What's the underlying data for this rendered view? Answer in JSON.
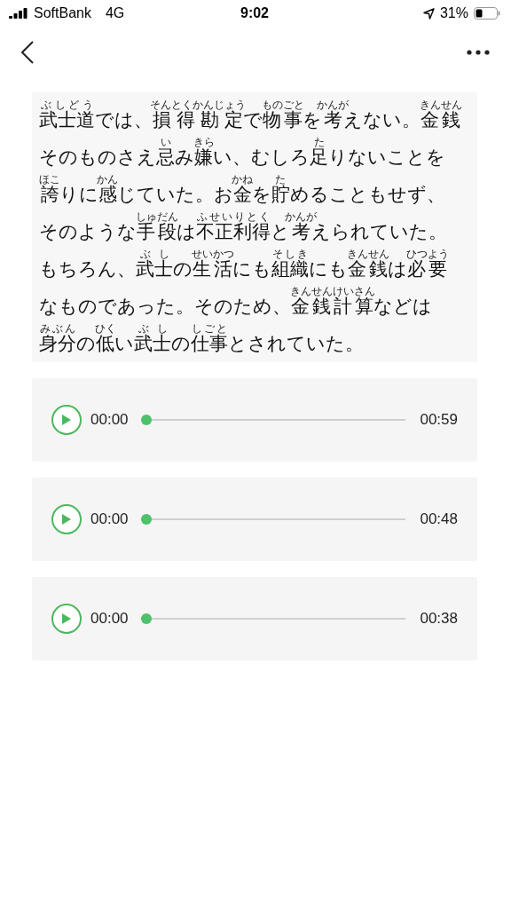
{
  "status_bar": {
    "carrier": "SoftBank",
    "network": "4G",
    "time": "9:02",
    "battery": "31%"
  },
  "passage": {
    "lines": [
      {
        "segments": [
          {
            "text": "武士道",
            "ruby": "ぶしどう"
          },
          {
            "text": "では、"
          },
          {
            "text": "損得勘定",
            "ruby": "そんとくかんじょう"
          },
          {
            "text": "で"
          },
          {
            "text": "物事",
            "ruby": "ものごと"
          },
          {
            "text": "を"
          },
          {
            "text": "考",
            "ruby": "かんが"
          },
          {
            "text": "えない。"
          },
          {
            "text": "金銭",
            "ruby": "きんせん"
          }
        ]
      },
      {
        "segments": [
          {
            "text": "そのものさえ"
          },
          {
            "text": "忌",
            "ruby": "い"
          },
          {
            "text": "み"
          },
          {
            "text": "嫌",
            "ruby": "きら"
          },
          {
            "text": "い、むしろ"
          },
          {
            "text": "足",
            "ruby": "た"
          },
          {
            "text": "りないことを"
          }
        ]
      },
      {
        "segments": [
          {
            "text": "誇",
            "ruby": "ほこ"
          },
          {
            "text": "りに"
          },
          {
            "text": "感",
            "ruby": "かん"
          },
          {
            "text": "じていた。お"
          },
          {
            "text": "金",
            "ruby": "かね"
          },
          {
            "text": "を"
          },
          {
            "text": "貯",
            "ruby": "た"
          },
          {
            "text": "めることもせず、"
          }
        ]
      },
      {
        "segments": [
          {
            "text": "そのような"
          },
          {
            "text": "手段",
            "ruby": "しゅだん"
          },
          {
            "text": "は"
          },
          {
            "text": "不正利得",
            "ruby": "ふせいりとく"
          },
          {
            "text": "と"
          },
          {
            "text": "考",
            "ruby": "かんが"
          },
          {
            "text": "えられていた。"
          }
        ]
      },
      {
        "segments": [
          {
            "text": "もちろん、"
          },
          {
            "text": "武士",
            "ruby": "ぶし"
          },
          {
            "text": "の"
          },
          {
            "text": "生活",
            "ruby": "せいかつ"
          },
          {
            "text": "にも"
          },
          {
            "text": "組織",
            "ruby": "そしき"
          },
          {
            "text": "にも"
          },
          {
            "text": "金銭",
            "ruby": "きんせん"
          },
          {
            "text": "は"
          },
          {
            "text": "必要",
            "ruby": "ひつよう"
          }
        ]
      },
      {
        "segments": [
          {
            "text": "なものであった。そのため、"
          },
          {
            "text": "金銭計算",
            "ruby": "きんせんけいさん"
          },
          {
            "text": "などは"
          }
        ]
      },
      {
        "segments": [
          {
            "text": "身分",
            "ruby": "みぶん"
          },
          {
            "text": "の"
          },
          {
            "text": "低",
            "ruby": "ひく"
          },
          {
            "text": "い"
          },
          {
            "text": "武士",
            "ruby": "ぶし"
          },
          {
            "text": "の"
          },
          {
            "text": "仕事",
            "ruby": "しごと"
          },
          {
            "text": "とされていた。"
          }
        ]
      }
    ]
  },
  "players": [
    {
      "current": "00:00",
      "duration": "00:59",
      "level": 0
    },
    {
      "current": "00:00",
      "duration": "00:48",
      "level": 0
    },
    {
      "current": "00:00",
      "duration": "00:38",
      "level": 0
    }
  ]
}
